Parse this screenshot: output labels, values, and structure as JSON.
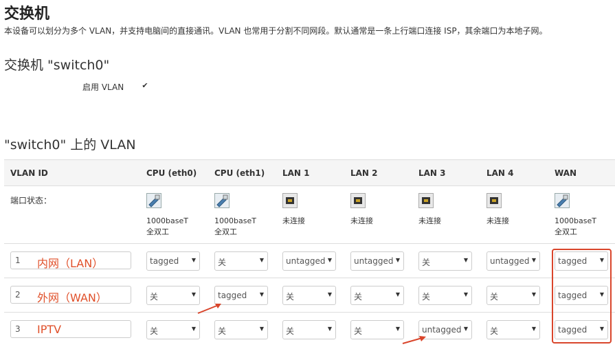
{
  "page": {
    "title": "交换机",
    "description": "本设备可以划分为多个 VLAN，并支持电脑间的直接通讯。VLAN 也常用于分割不同网段。默认通常是一条上行端口连接 ISP，其余端口为本地子网。",
    "switch_heading": "交换机 \"switch0\"",
    "enable_vlan_label": "启用 VLAN",
    "enable_vlan_checked": true,
    "vlan_heading": "\"switch0\" 上的 VLAN"
  },
  "table": {
    "headers": [
      "VLAN ID",
      "CPU (eth0)",
      "CPU (eth1)",
      "LAN 1",
      "LAN 2",
      "LAN 3",
      "LAN 4",
      "WAN"
    ],
    "port_status_label": "端口状态：",
    "ports": [
      {
        "icon": "ethernet-connected-icon",
        "line1": "1000baseT",
        "line2": "全双工"
      },
      {
        "icon": "ethernet-connected-icon",
        "line1": "1000baseT",
        "line2": "全双工"
      },
      {
        "icon": "ethernet-disconnected-icon",
        "line1": "未连接",
        "line2": ""
      },
      {
        "icon": "ethernet-disconnected-icon",
        "line1": "未连接",
        "line2": ""
      },
      {
        "icon": "ethernet-disconnected-icon",
        "line1": "未连接",
        "line2": ""
      },
      {
        "icon": "ethernet-disconnected-icon",
        "line1": "未连接",
        "line2": ""
      },
      {
        "icon": "ethernet-connected-icon",
        "line1": "1000baseT",
        "line2": "全双工"
      }
    ],
    "rows": [
      {
        "id": "1",
        "note": "内网（LAN）",
        "cells": [
          "tagged",
          "关",
          "untagged",
          "untagged",
          "关",
          "untagged",
          "tagged"
        ]
      },
      {
        "id": "2",
        "note": "外网（WAN）",
        "cells": [
          "关",
          "tagged",
          "关",
          "关",
          "关",
          "关",
          "tagged"
        ]
      },
      {
        "id": "3",
        "note": "IPTV",
        "cells": [
          "关",
          "关",
          "关",
          "关",
          "untagged",
          "关",
          "tagged"
        ]
      }
    ]
  },
  "colors": {
    "annotation": "#e0502a",
    "highlight_box": "#d9452b"
  }
}
